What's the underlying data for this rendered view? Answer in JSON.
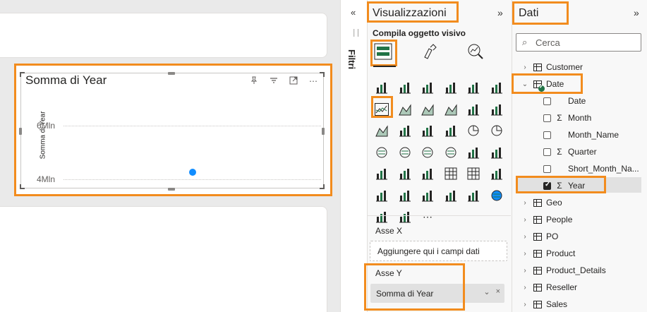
{
  "visual": {
    "title": "Somma di Year",
    "y_axis_title": "Somma di Year",
    "tools": [
      "pin-icon",
      "filter-icon",
      "focus-mode-icon",
      "more-options-icon"
    ]
  },
  "chart_data": {
    "type": "scatter",
    "title": "Somma di Year",
    "ylabel": "Somma di Year",
    "y_ticks": [
      "6Mln",
      "4Mln"
    ],
    "points": [
      {
        "y": 5000000
      }
    ],
    "ylim": [
      4000000,
      6000000
    ],
    "grid": true,
    "color": "#118dff"
  },
  "filters": {
    "label": "Filtri"
  },
  "viz_pane": {
    "title": "Visualizzazioni",
    "subtitle": "Compila oggetto visivo",
    "modes": [
      "build-visual",
      "format-visual",
      "analytics"
    ],
    "wells": [
      {
        "label": "Asse X",
        "placeholder": "Aggiungere qui i campi dati"
      },
      {
        "label": "Asse Y",
        "field": "Somma di Year"
      }
    ]
  },
  "data_pane": {
    "title": "Dati",
    "search_placeholder": "Cerca",
    "tables": [
      {
        "name": "Customer",
        "expanded": false
      },
      {
        "name": "Date",
        "expanded": true,
        "fields": [
          {
            "name": "Date",
            "sigma": false,
            "checked": false
          },
          {
            "name": "Month",
            "sigma": true,
            "checked": false
          },
          {
            "name": "Month_Name",
            "sigma": false,
            "checked": false
          },
          {
            "name": "Quarter",
            "sigma": true,
            "checked": false
          },
          {
            "name": "Short_Month_Na...",
            "sigma": false,
            "checked": false
          },
          {
            "name": "Year",
            "sigma": true,
            "checked": true
          }
        ]
      },
      {
        "name": "Geo",
        "expanded": false
      },
      {
        "name": "People",
        "expanded": false
      },
      {
        "name": "PO",
        "expanded": false
      },
      {
        "name": "Product",
        "expanded": false
      },
      {
        "name": "Product_Details",
        "expanded": false
      },
      {
        "name": "Reseller",
        "expanded": false
      },
      {
        "name": "Sales",
        "expanded": false
      }
    ]
  },
  "colors": {
    "highlight": "#f28c1e",
    "accent": "#118dff"
  }
}
